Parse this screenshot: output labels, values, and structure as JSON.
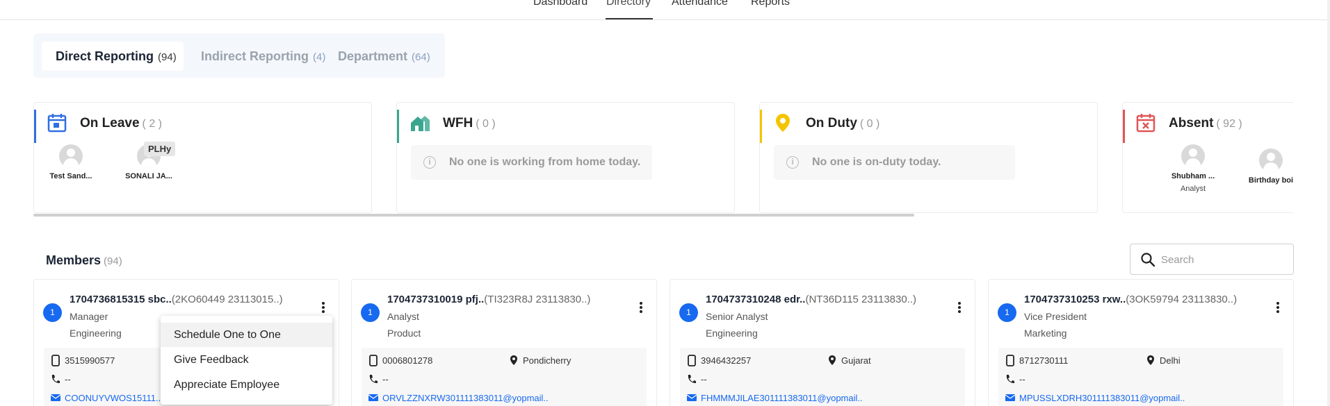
{
  "topnav": {
    "tabs": [
      {
        "label": "Dashboard"
      },
      {
        "label": "Directory"
      },
      {
        "label": "Attendance"
      },
      {
        "label": "Reports"
      }
    ]
  },
  "reporting_tabs": [
    {
      "label": "Direct Reporting",
      "count": "(94)"
    },
    {
      "label": "Indirect Reporting",
      "count": "(4)"
    },
    {
      "label": "Department",
      "count": "(64)"
    }
  ],
  "status_cards": {
    "on_leave": {
      "title": "On Leave",
      "count": "( 2 )",
      "color": "#2f6fe0",
      "people": [
        {
          "name": "Test Sand..."
        },
        {
          "name": "SONALI JA..."
        }
      ],
      "tooltip": "PLHy"
    },
    "wfh": {
      "title": "WFH",
      "count": "( 0 )",
      "color": "#3aa68f",
      "empty": "No one is working from home today."
    },
    "on_duty": {
      "title": "On Duty",
      "count": "( 0 )",
      "color": "#f5c400",
      "empty": "No one is on-duty today."
    },
    "absent": {
      "title": "Absent",
      "count": "( 92 )",
      "color": "#e05555",
      "people": [
        {
          "name": "Shubham ...",
          "role": "Analyst"
        },
        {
          "name": "Birthday boi"
        }
      ]
    }
  },
  "members": {
    "title": "Members",
    "count": "(94)",
    "search_placeholder": "Search",
    "cards": [
      {
        "badge": "1",
        "name": "1704736815315 sbc..",
        "code": "(2KO60449 23113015..)",
        "role": "Manager",
        "dept": "Engineering",
        "phone": "3515990577",
        "location": "",
        "landline": "--",
        "email": "COONUYVWOS15111..."
      },
      {
        "badge": "1",
        "name": "1704737310019 pfj..",
        "code": "(TI323R8J 23113830..)",
        "role": "Analyst",
        "dept": "Product",
        "phone": "0006801278",
        "location": "Pondicherry",
        "landline": "--",
        "email": "ORVLZZNXRW301111383011@yopmail.."
      },
      {
        "badge": "1",
        "name": "1704737310248 edr..",
        "code": "(NT36D115 23113830..)",
        "role": "Senior Analyst",
        "dept": "Engineering",
        "phone": "3946432257",
        "location": "Gujarat",
        "landline": "--",
        "email": "FHMMMJILAE301111383011@yopmail.."
      },
      {
        "badge": "1",
        "name": "1704737310253 rxw..",
        "code": "(3OK59794 23113830..)",
        "role": "Vice President",
        "dept": "Marketing",
        "phone": "8712730111",
        "location": "Delhi",
        "landline": "--",
        "email": "MPUSSLXDRH301111383011@yopmail.."
      }
    ]
  },
  "context_menu": {
    "items": [
      {
        "label": "Schedule One to One"
      },
      {
        "label": "Give Feedback"
      },
      {
        "label": "Appreciate Employee"
      }
    ]
  }
}
